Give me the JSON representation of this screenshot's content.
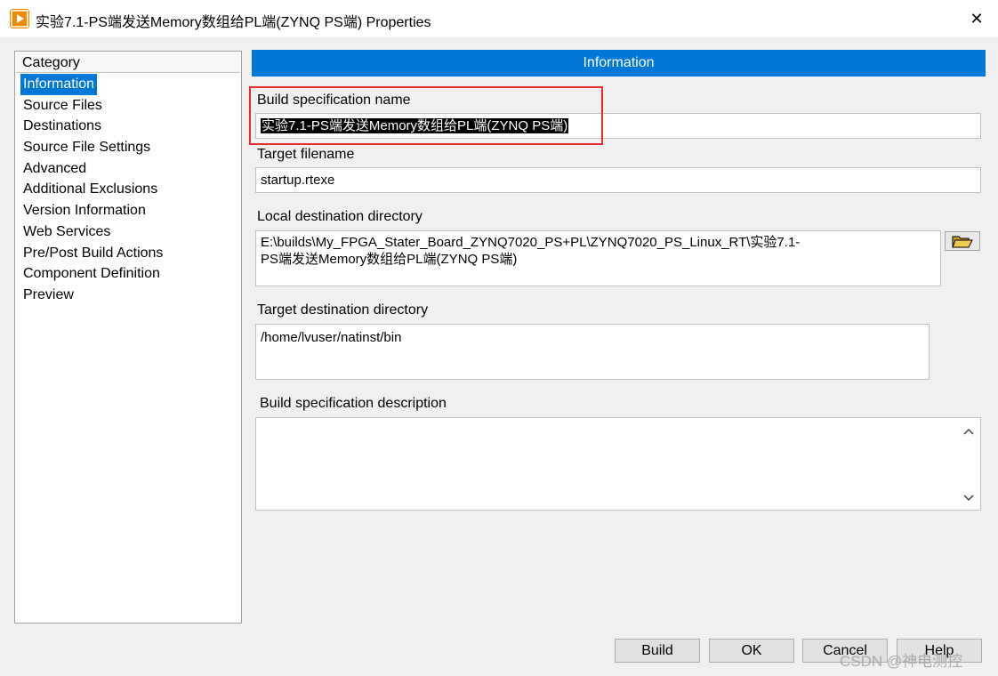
{
  "window": {
    "title": "实验7.1-PS端发送Memory数组给PL端(ZYNQ PS端) Properties",
    "close_glyph": "✕",
    "app_icon": "labview-icon",
    "accent_color": "#0078d7"
  },
  "sidebar": {
    "header": "Category",
    "items": [
      {
        "label": "Information",
        "selected": true
      },
      {
        "label": "Source Files"
      },
      {
        "label": "Destinations"
      },
      {
        "label": "Source File Settings"
      },
      {
        "label": "Advanced"
      },
      {
        "label": "Additional Exclusions"
      },
      {
        "label": "Version Information"
      },
      {
        "label": "Web Services"
      },
      {
        "label": "Pre/Post Build Actions"
      },
      {
        "label": "Component Definition"
      },
      {
        "label": "Preview"
      }
    ]
  },
  "main": {
    "header": "Information",
    "build_spec_name": {
      "label": "Build specification name",
      "value": "实验7.1-PS端发送Memory数组给PL端(ZYNQ PS端)"
    },
    "target_filename": {
      "label": "Target filename",
      "value": "startup.rtexe"
    },
    "local_destination": {
      "label": "Local destination directory",
      "value_line1": "E:\\builds\\My_FPGA_Stater_Board_ZYNQ7020_PS+PL\\ZYNQ7020_PS_Linux_RT\\实验7.1-",
      "value_line2": "PS端发送Memory数组给PL端(ZYNQ PS端)",
      "browse_icon": "folder-open-icon"
    },
    "target_destination": {
      "label": "Target destination directory",
      "value": "/home/lvuser/natinst/bin"
    },
    "description": {
      "label": "Build specification description",
      "value": ""
    }
  },
  "footer": {
    "buttons": [
      "Build",
      "OK",
      "Cancel",
      "Help"
    ]
  },
  "watermark": "CSDN @神电测控"
}
